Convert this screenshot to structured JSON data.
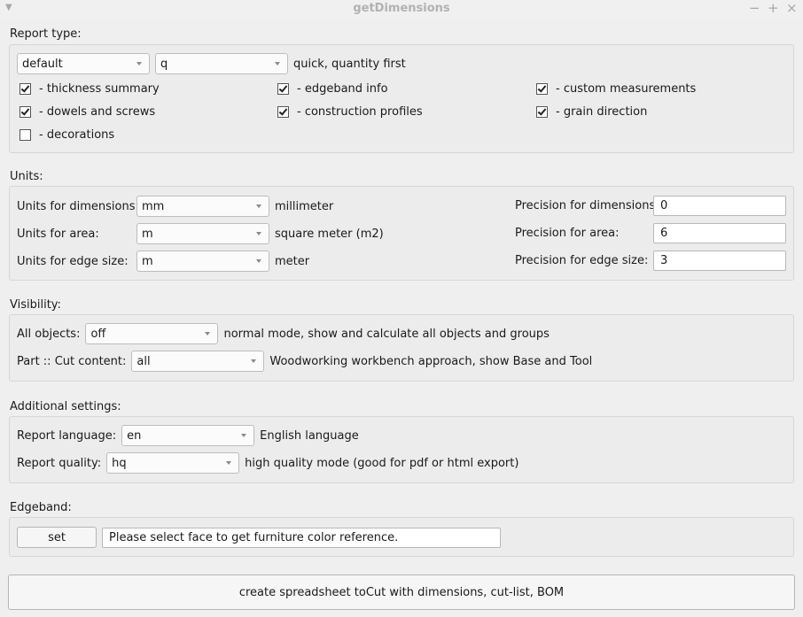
{
  "window": {
    "title": "getDimensions"
  },
  "report": {
    "section_label": "Report type:",
    "type_value": "default",
    "quality_value": "q",
    "quality_desc": "quick, quantity first",
    "options": [
      {
        "label": "- thickness summary",
        "checked": true
      },
      {
        "label": "- edgeband info",
        "checked": true
      },
      {
        "label": "- custom measurements",
        "checked": true
      },
      {
        "label": "- dowels and screws",
        "checked": true
      },
      {
        "label": "- construction profiles",
        "checked": true
      },
      {
        "label": "- grain direction",
        "checked": true
      },
      {
        "label": "- decorations",
        "checked": false
      }
    ]
  },
  "units": {
    "section_label": "Units:",
    "dimensions": {
      "label": "Units for dimensions:",
      "value": "mm",
      "desc": "millimeter",
      "precision_label": "Precision for dimensions:",
      "precision": "0"
    },
    "area": {
      "label": "Units for area:",
      "value": "m",
      "desc": "square meter (m2)",
      "precision_label": "Precision for area:",
      "precision": "6"
    },
    "edge": {
      "label": "Units for edge size:",
      "value": "m",
      "desc": "meter",
      "precision_label": "Precision for edge size:",
      "precision": "3"
    }
  },
  "visibility": {
    "section_label": "Visibility:",
    "all_objects": {
      "label": "All objects:",
      "value": "off",
      "desc": "normal mode, show and calculate all objects and groups"
    },
    "part_cut": {
      "label": "Part :: Cut content:",
      "value": "all",
      "desc": "Woodworking workbench approach, show Base and Tool"
    }
  },
  "additional": {
    "section_label": "Additional settings:",
    "language": {
      "label": "Report language:",
      "value": "en",
      "desc": "English language"
    },
    "quality": {
      "label": "Report quality:",
      "value": "hq",
      "desc": "high quality mode (good for pdf or html export)"
    }
  },
  "edgeband": {
    "section_label": "Edgeband:",
    "set_label": "set",
    "field_value": "Please select face to get furniture color reference."
  },
  "create_button_label": "create spreadsheet toCut with dimensions, cut-list, BOM"
}
